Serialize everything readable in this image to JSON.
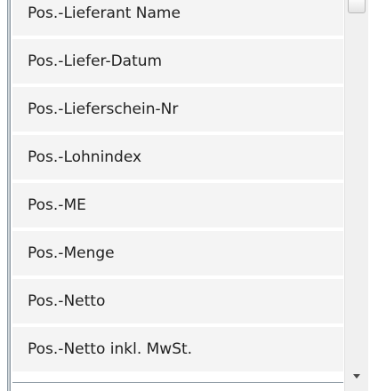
{
  "list": {
    "items": [
      {
        "label": "Pos.-Lieferant Name"
      },
      {
        "label": "Pos.-Liefer-Datum"
      },
      {
        "label": "Pos.-Lieferschein-Nr"
      },
      {
        "label": "Pos.-Lohnindex"
      },
      {
        "label": "Pos.-ME"
      },
      {
        "label": "Pos.-Menge"
      },
      {
        "label": "Pos.-Netto"
      },
      {
        "label": "Pos.-Netto inkl. MwSt."
      }
    ]
  },
  "scrollbar": {
    "down_arrow_icon": "triangle-down-icon"
  }
}
